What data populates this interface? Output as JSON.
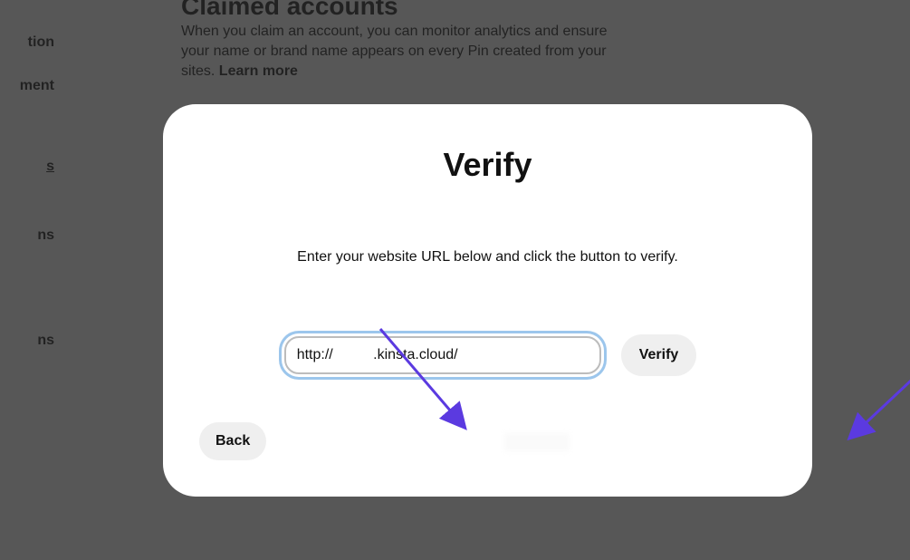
{
  "background": {
    "heading": "Claimed accounts",
    "description_prefix": "When you claim an account, you can monitor analytics and ensure your name or brand name appears on every Pin created from your sites. ",
    "learn_more": "Learn more",
    "sidebar": [
      "tion",
      "ment",
      "s",
      "ns",
      "ns"
    ]
  },
  "modal": {
    "title": "Verify",
    "instruction": "Enter your website URL below and click the button to verify.",
    "url_value": "http://          .kinsta.cloud/",
    "verify_label": "Verify",
    "back_label": "Back"
  },
  "annotations": {
    "arrow_color": "#5b3ae0"
  }
}
